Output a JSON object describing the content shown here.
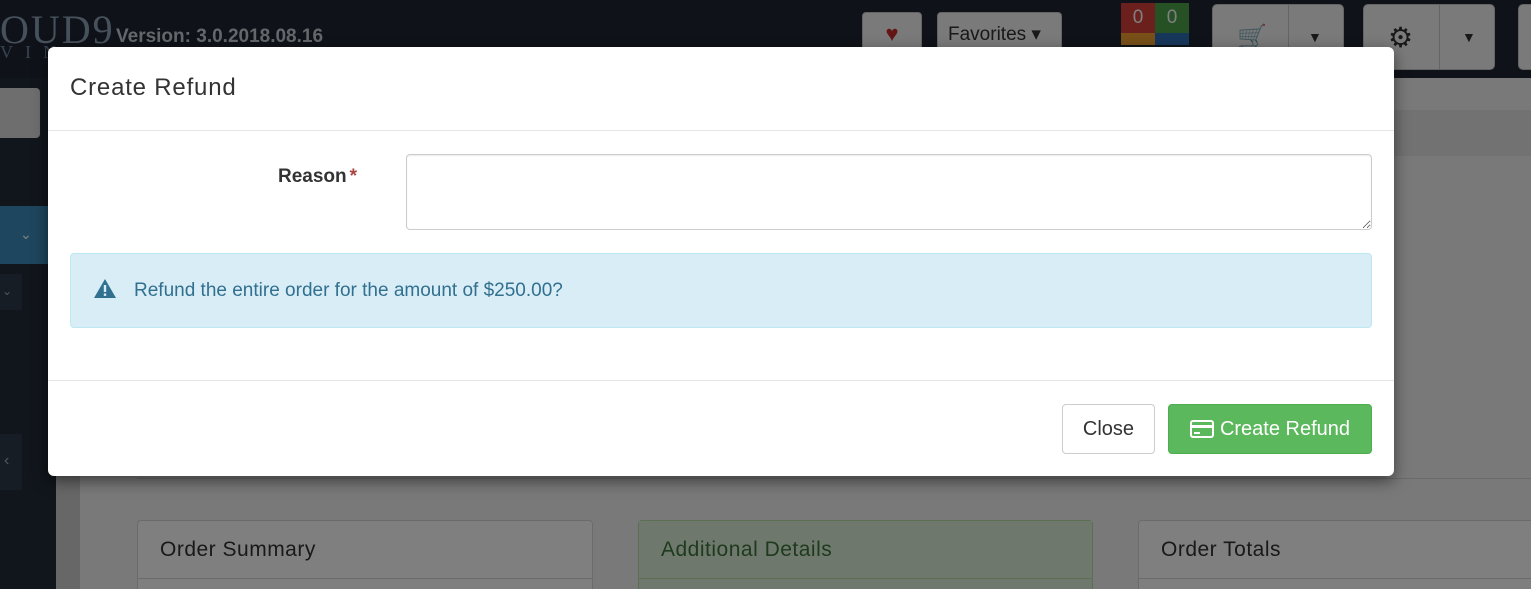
{
  "app": {
    "logo_main": "OUD9",
    "logo_sub": "VIN",
    "version": "Version: 3.0.2018.08.16",
    "favorites_label": "Favorites",
    "counters": [
      "0",
      "0"
    ],
    "panels": [
      {
        "title": "Order Summary"
      },
      {
        "title": "Additional Details"
      },
      {
        "title": "Order Totals"
      }
    ]
  },
  "modal": {
    "title": "Create Refund",
    "reason_label": "Reason",
    "reason_required": "*",
    "reason_value": "",
    "alert_text": "Refund the entire order for the amount of $250.00?",
    "close_label": "Close",
    "create_label": "Create Refund"
  },
  "icons": {
    "alert": "warning-triangle-icon",
    "create": "credit-card-icon",
    "favorite": "heart-icon",
    "cart": "cart-icon",
    "settings": "gears-icon"
  },
  "colors": {
    "primary_success": "#5cb85c",
    "alert_bg": "#d9edf7",
    "alert_text": "#31708f",
    "required": "#a94442",
    "topbar": "#1e2733"
  }
}
